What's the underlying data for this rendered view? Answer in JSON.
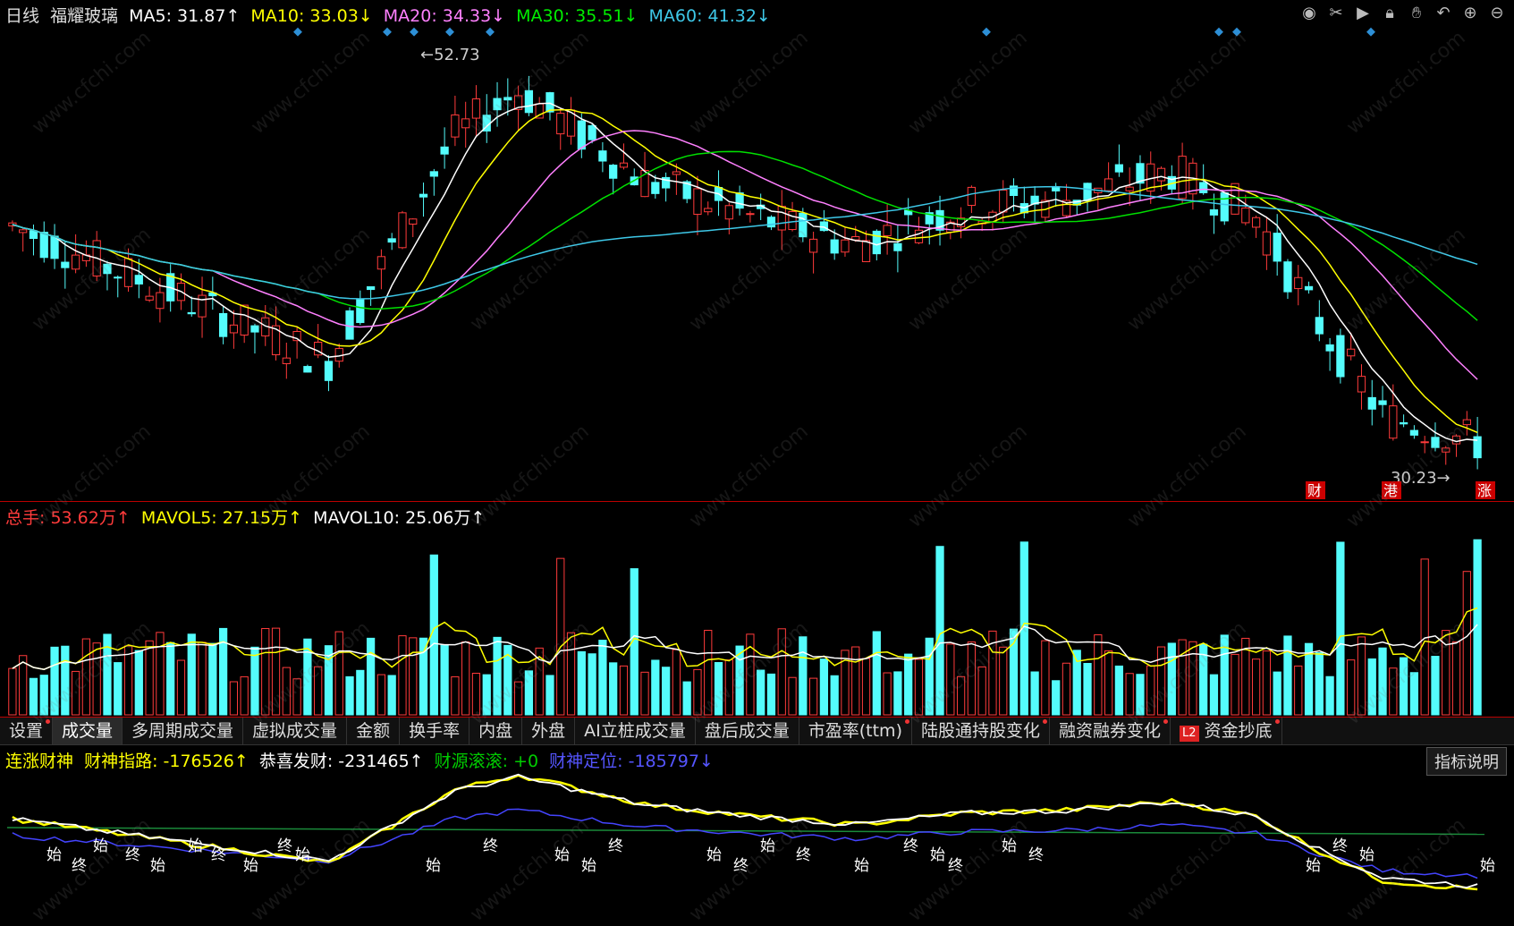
{
  "header": {
    "period": "日线",
    "stock_name": "福耀玻璃",
    "ma5": "MA5: 31.87↑",
    "ma10": "MA10: 33.03↓",
    "ma20": "MA20: 34.33↓",
    "ma30": "MA30: 35.51↓",
    "ma60": "MA60: 41.32↓"
  },
  "toolbar_icons": [
    "eye-icon",
    "scissors-icon",
    "play-icon",
    "lock-icon",
    "hand-icon",
    "undo-icon",
    "zoom-in-icon",
    "zoom-out-icon"
  ],
  "price_labels": {
    "high": "52.73",
    "low": "30.23"
  },
  "markers": {
    "m1": "财",
    "m2": "港",
    "m3": "涨"
  },
  "volume": {
    "total": "总手: 53.62万↑",
    "mavol5": "MAVOL5: 27.15万↑",
    "mavol10": "MAVOL10: 25.06万↑"
  },
  "tabs": [
    {
      "label": "设置",
      "dot": true
    },
    {
      "label": "成交量",
      "dot": false,
      "active": true
    },
    {
      "label": "多周期成交量",
      "dot": false
    },
    {
      "label": "虚拟成交量",
      "dot": false
    },
    {
      "label": "金额",
      "dot": false
    },
    {
      "label": "换手率",
      "dot": false
    },
    {
      "label": "内盘",
      "dot": false
    },
    {
      "label": "外盘",
      "dot": false
    },
    {
      "label": "AI立桩成交量",
      "dot": false
    },
    {
      "label": "盘后成交量",
      "dot": false
    },
    {
      "label": "市盈率(ttm)",
      "dot": true
    },
    {
      "label": "陆股通持股变化",
      "dot": true
    },
    {
      "label": "融资融券变化",
      "dot": true
    },
    {
      "label": "资金抄底",
      "dot": true,
      "badge": "L2"
    }
  ],
  "indicator": {
    "name": "连涨财神",
    "line1": "财神指路: -176526↑",
    "line2": "恭喜发财: -231465↑",
    "line3": "财源滚滚: +0",
    "line4": "财神定位: -185797↓",
    "help_button": "指标说明",
    "labels": [
      "始",
      "终",
      "始",
      "终",
      "始",
      "始",
      "终",
      "始",
      "终",
      "始",
      "始",
      "终",
      "始",
      "始",
      "终",
      "始",
      "终",
      "始",
      "终",
      "始",
      "终",
      "始",
      "终",
      "始",
      "终",
      "始",
      "终",
      "始",
      "始"
    ]
  },
  "watermark": "www.cfchi.com",
  "colors": {
    "up": "#ff3b3b",
    "down": "#54fcfc",
    "ma5": "#ffffff",
    "ma10": "#ffff00",
    "ma20": "#ff80ff",
    "ma30": "#00e000",
    "ma60": "#3ec8e8"
  }
}
